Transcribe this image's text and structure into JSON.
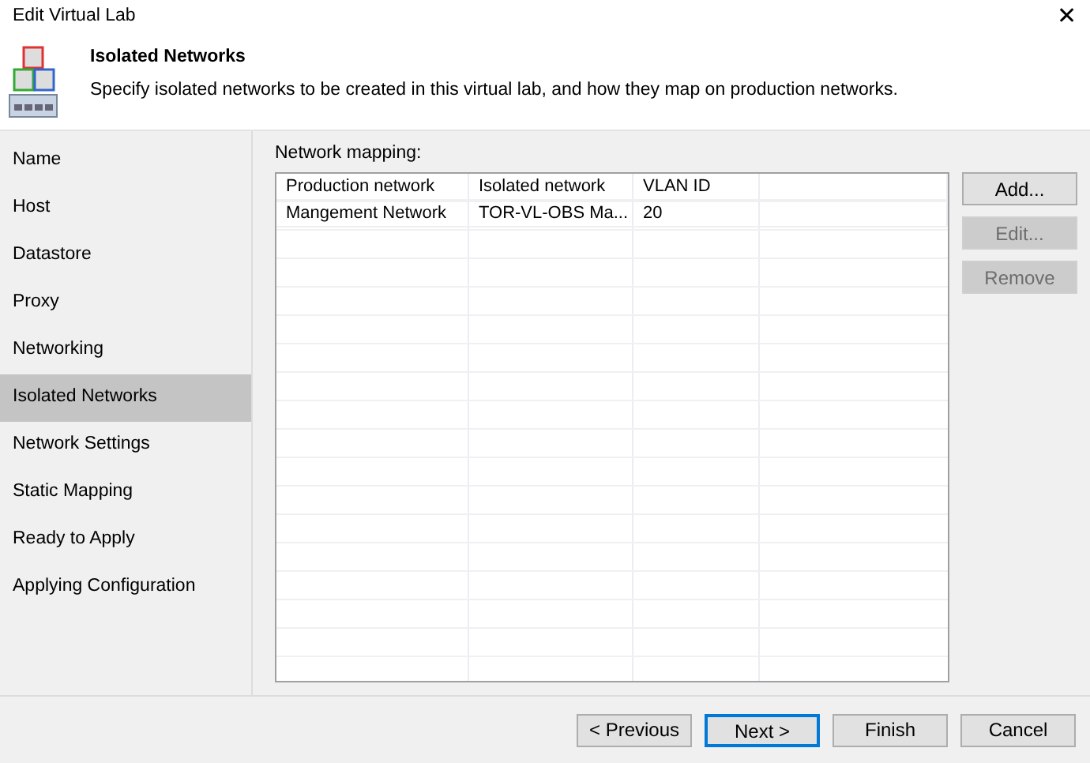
{
  "window": {
    "title": "Edit Virtual Lab",
    "close": "✕"
  },
  "header": {
    "title": "Isolated Networks",
    "description": "Specify isolated networks to be created in this virtual lab, and how they map on production networks."
  },
  "sidebar": {
    "items": [
      {
        "label": "Name",
        "selected": false
      },
      {
        "label": "Host",
        "selected": false
      },
      {
        "label": "Datastore",
        "selected": false
      },
      {
        "label": "Proxy",
        "selected": false
      },
      {
        "label": "Networking",
        "selected": false
      },
      {
        "label": "Isolated Networks",
        "selected": true
      },
      {
        "label": "Network Settings",
        "selected": false
      },
      {
        "label": "Static Mapping",
        "selected": false
      },
      {
        "label": "Ready to Apply",
        "selected": false
      },
      {
        "label": "Applying Configuration",
        "selected": false
      }
    ]
  },
  "mapping": {
    "label": "Network mapping:",
    "table": {
      "columns": [
        "Production network",
        "Isolated network",
        "VLAN ID"
      ],
      "rows": [
        [
          "Mangement Network",
          "TOR-VL-OBS Ma...",
          "20"
        ]
      ]
    },
    "buttons": [
      {
        "label": "Add...",
        "disabled": false
      },
      {
        "label": "Edit...",
        "disabled": true
      },
      {
        "label": "Remove",
        "disabled": true
      }
    ]
  },
  "footer": {
    "buttons": [
      {
        "label": "< Previous",
        "focused": false
      },
      {
        "label": "Next >",
        "focused": true
      },
      {
        "label": "Finish",
        "focused": false
      },
      {
        "label": "Cancel",
        "focused": false
      }
    ]
  }
}
